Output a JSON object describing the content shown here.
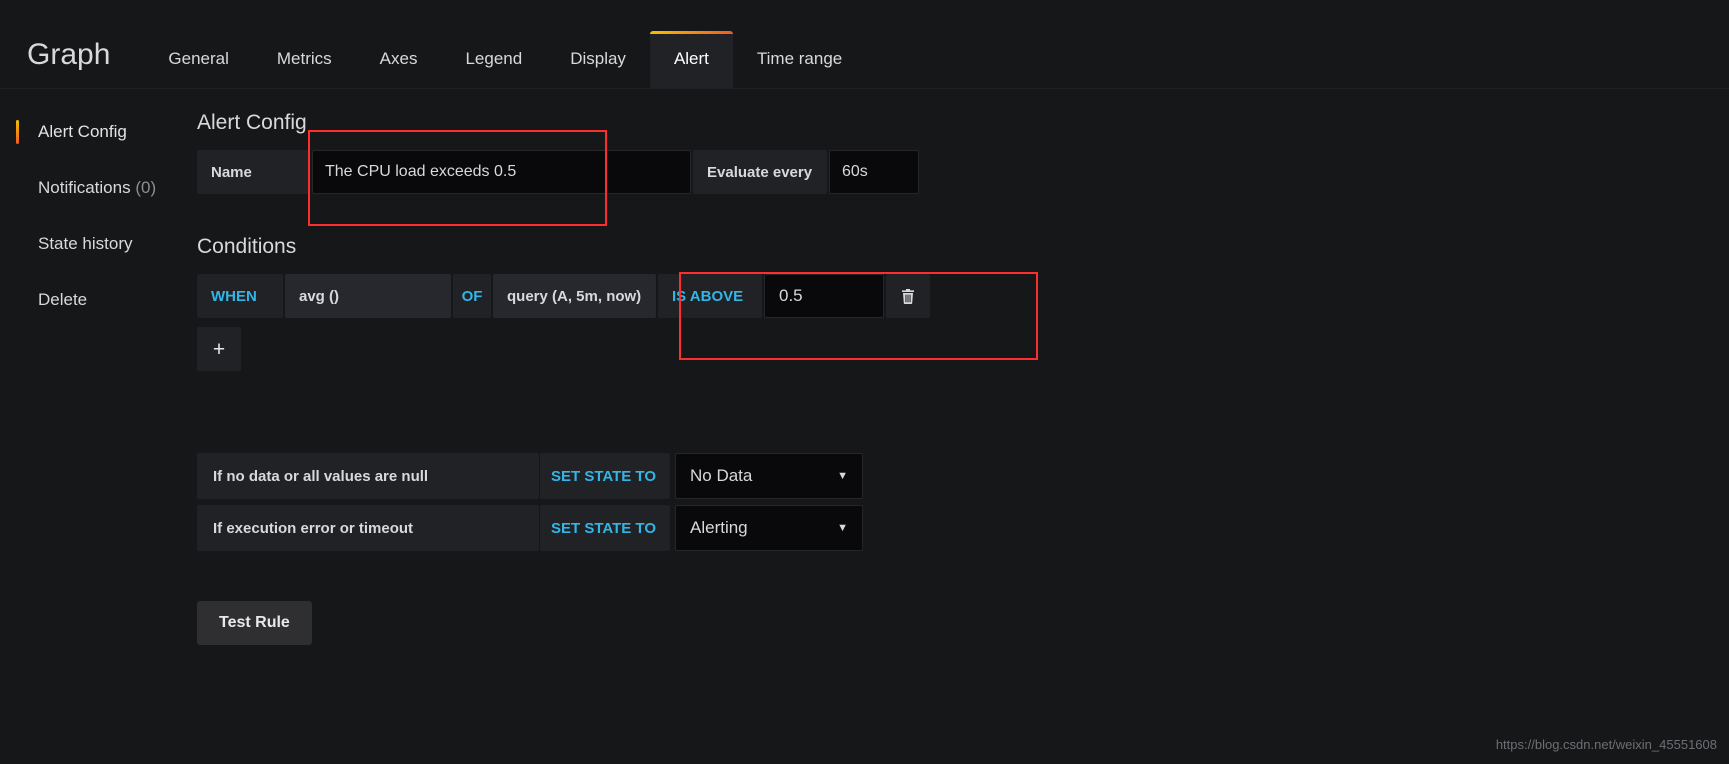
{
  "header": {
    "panel_title": "Graph",
    "tabs": [
      {
        "label": "General",
        "active": false
      },
      {
        "label": "Metrics",
        "active": false
      },
      {
        "label": "Axes",
        "active": false
      },
      {
        "label": "Legend",
        "active": false
      },
      {
        "label": "Display",
        "active": false
      },
      {
        "label": "Alert",
        "active": true
      },
      {
        "label": "Time range",
        "active": false
      }
    ],
    "accent_gradient_start": "#f2c200",
    "accent_gradient_end": "#f05a28"
  },
  "sidebar": {
    "items": [
      {
        "label": "Alert Config",
        "count": "",
        "active": true
      },
      {
        "label": "Notifications",
        "count": "(0)",
        "active": false
      },
      {
        "label": "State history",
        "count": "",
        "active": false
      },
      {
        "label": "Delete",
        "count": "",
        "active": false
      }
    ]
  },
  "alert_config": {
    "section_title": "Alert Config",
    "name_label": "Name",
    "name_value": "The CPU load exceeds 0.5",
    "name_placeholder": "Name",
    "evaluate_label": "Evaluate every",
    "evaluate_value": "60s"
  },
  "conditions": {
    "section_title": "Conditions",
    "rows": [
      {
        "when_label": "WHEN",
        "reducer": "avg ()",
        "of_label": "OF",
        "query": "query (A, 5m, now)",
        "evaluator_type": "IS ABOVE",
        "threshold": "0.5",
        "delete_icon": "trash-icon"
      }
    ],
    "add_label": "+",
    "add_icon": "plus-icon"
  },
  "handling": {
    "rows": [
      {
        "description": "If no data or all values are null",
        "set_state_label": "SET STATE TO",
        "state_value": "No Data",
        "chevron_icon": "chevron-down-icon"
      },
      {
        "description": "If execution error or timeout",
        "set_state_label": "SET STATE TO",
        "state_value": "Alerting",
        "chevron_icon": "chevron-down-icon"
      }
    ]
  },
  "actions": {
    "test_rule_label": "Test Rule"
  },
  "annotations": {
    "highlight_color": "#ff2d2d",
    "boxes": [
      "alert-name-field",
      "condition-evaluator"
    ]
  },
  "watermark": {
    "text": "https://blog.csdn.net/weixin_45551608"
  }
}
